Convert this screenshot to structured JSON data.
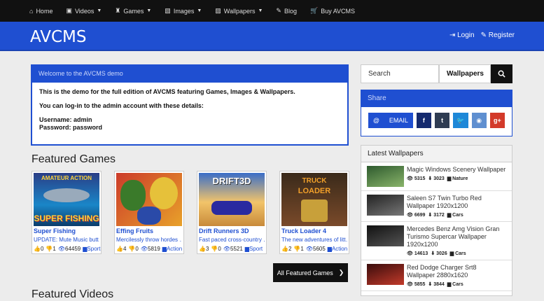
{
  "nav": {
    "items": [
      {
        "label": "Home",
        "icon": "home-icon",
        "glyph": "⌂",
        "dropdown": false
      },
      {
        "label": "Videos",
        "icon": "video-icon",
        "glyph": "▣",
        "dropdown": true
      },
      {
        "label": "Games",
        "icon": "gamepad-icon",
        "glyph": "♜",
        "dropdown": true
      },
      {
        "label": "Images",
        "icon": "image-icon",
        "glyph": "▧",
        "dropdown": true
      },
      {
        "label": "Wallpapers",
        "icon": "picture-icon",
        "glyph": "▨",
        "dropdown": true
      },
      {
        "label": "Blog",
        "icon": "pencil-icon",
        "glyph": "✎",
        "dropdown": false
      },
      {
        "label": "Buy AVCMS",
        "icon": "cart-icon",
        "glyph": "🛒",
        "dropdown": false
      }
    ]
  },
  "header": {
    "brand": "AVCMS",
    "login": "Login",
    "register": "Register"
  },
  "welcome": {
    "title": "Welcome to the AVCMS demo",
    "line1": "This is the demo for the full edition of AVCMS featuring Games, Images & Wallpapers.",
    "line2": "You can log-in to the admin account with these details:",
    "username": "Username: admin",
    "password": "Password: password"
  },
  "featured_games": {
    "title": "Featured Games",
    "button": "All Featured Games",
    "items": [
      {
        "title": "Super Fishing",
        "desc": "UPDATE: Mute Music butt…",
        "likes": "0",
        "dislikes": "1",
        "views": "64459",
        "category": "Sport",
        "thumb_text": "SUPER FISHING",
        "thumb_top": "AMATEUR ACTION"
      },
      {
        "title": "Effing Fruits",
        "desc": "Mercilessly throw hordes …",
        "likes": "4",
        "dislikes": "0",
        "views": "5819",
        "category": "Action",
        "thumb_text": "",
        "thumb_top": ""
      },
      {
        "title": "Drift Runners 3D",
        "desc": "Fast paced cross-country …",
        "likes": "3",
        "dislikes": "0",
        "views": "5521",
        "category": "Sport",
        "thumb_text": "",
        "thumb_top": "DRIFT3D"
      },
      {
        "title": "Truck Loader 4",
        "desc": "The new adventures of litt…",
        "likes": "2",
        "dislikes": "1",
        "views": "5605",
        "category": "Action",
        "thumb_text": "LOADER",
        "thumb_top": "TRUCK"
      }
    ]
  },
  "featured_videos": {
    "title": "Featured Videos"
  },
  "search": {
    "placeholder": "Search",
    "selected": "Wallpapers"
  },
  "share": {
    "title": "Share",
    "email": "EMAIL"
  },
  "latest_wallpapers": {
    "title": "Latest Wallpapers",
    "items": [
      {
        "title": "Magic Windows Scenery Wallpaper",
        "views": "5315",
        "downloads": "3023",
        "category": "Nature",
        "c1": "#2e5a2e",
        "c2": "#89b46a"
      },
      {
        "title": "Saleen S7 Twin Turbo Red Wallpaper 1920x1200",
        "views": "6699",
        "downloads": "3172",
        "category": "Cars",
        "c1": "#222",
        "c2": "#777"
      },
      {
        "title": "Mercedes Benz Amg Vision Gran Turismo Supercar Wallpaper 1920x1200",
        "views": "14613",
        "downloads": "3026",
        "category": "Cars",
        "c1": "#111",
        "c2": "#555"
      },
      {
        "title": "Red Dodge Charger Srt8 Wallpaper 2880x1620",
        "views": "5855",
        "downloads": "3844",
        "category": "Cars",
        "c1": "#3a0c0c",
        "c2": "#c23a2a"
      }
    ]
  }
}
